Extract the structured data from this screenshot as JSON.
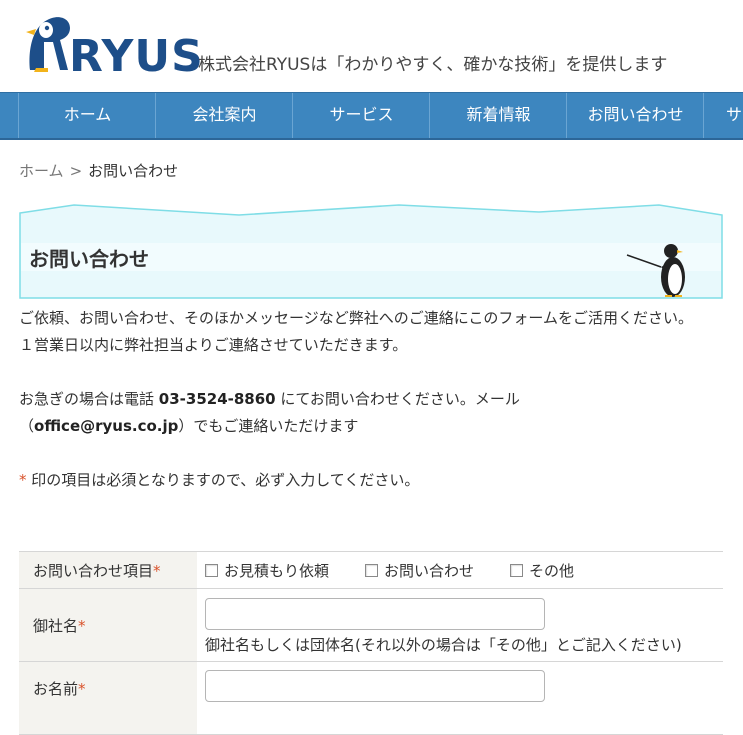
{
  "header": {
    "logo_text": "RYUS",
    "tagline": "株式会社RYUSは「わかりやすく、確かな技術」を提供します"
  },
  "nav": {
    "items": [
      {
        "label": "ホーム"
      },
      {
        "label": "会社案内"
      },
      {
        "label": "サービス"
      },
      {
        "label": "新着情報"
      },
      {
        "label": "お問い合わせ"
      },
      {
        "label": "サ"
      }
    ]
  },
  "breadcrumb": {
    "home": "ホーム",
    "separator": ">",
    "current": "お問い合わせ"
  },
  "page": {
    "title": "お問い合わせ"
  },
  "intro": {
    "line1": "ご依頼、お問い合わせ、そのほかメッセージなど弊社へのご連絡にこのフォームをご活用ください。",
    "line2": "１営業日以内に弊社担当よりご連絡させていただきます。",
    "urgent_prefix": "お急ぎの場合は電話 ",
    "phone": "03-3524-8860",
    "urgent_mid": " にてお問い合わせください。メール",
    "email_open": "（",
    "email": "office@ryus.co.jp",
    "email_close": "）でもご連絡いただけます",
    "required_mark": "*",
    "required_note": " 印の項目は必須となりますので、必ず入力してください。"
  },
  "form": {
    "required_mark": "*",
    "inquiry_type": {
      "label": "お問い合わせ項目",
      "options": [
        "お見積もり依頼",
        "お問い合わせ",
        "その他"
      ]
    },
    "company": {
      "label": "御社名",
      "value": "",
      "hint": "御社名もしくは団体名(それ以外の場合は「その他」とご記入ください)"
    },
    "name": {
      "label": "お名前",
      "value": ""
    }
  },
  "colors": {
    "nav_bg": "#3d86bf",
    "title_box_bg": "#e8f9fc",
    "title_box_border": "#7fdde6",
    "required": "#d9532c",
    "logo": "#1d4e89"
  }
}
